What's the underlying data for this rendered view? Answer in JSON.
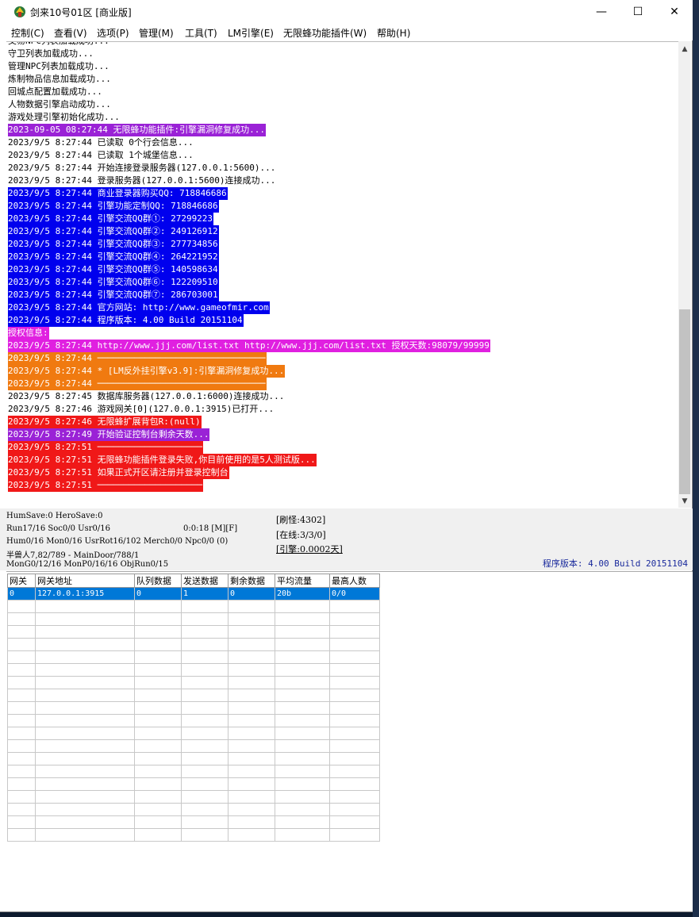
{
  "window": {
    "title": "剑来10号01区 [商业版]",
    "minimize": "—",
    "maximize": "☐",
    "close": "✕"
  },
  "menu": [
    {
      "label": "控制(C)"
    },
    {
      "label": "查看(V)"
    },
    {
      "label": "选项(P)"
    },
    {
      "label": "管理(M)"
    },
    {
      "label": "工具(T)"
    },
    {
      "label": "LM引擎(E)"
    },
    {
      "label": "无限蜂功能插件(W)"
    },
    {
      "label": "帮助(H)"
    }
  ],
  "colors": {
    "purple": "#9a22d6",
    "blue": "#0000ee",
    "magenta": "#e020e0",
    "orange": "#f07a10",
    "red": "#f01818",
    "highlight_row": "#0078d7",
    "version_text": "#1a2a9c"
  },
  "log": [
    {
      "text": "交易NPC列表加载成功...",
      "fg": "#000",
      "bg": ""
    },
    {
      "text": "守卫列表加载成功...",
      "fg": "#000",
      "bg": ""
    },
    {
      "text": "管理NPC列表加载成功...",
      "fg": "#000",
      "bg": ""
    },
    {
      "text": "炼制物品信息加载成功...",
      "fg": "#000",
      "bg": ""
    },
    {
      "text": "回城点配置加载成功...",
      "fg": "#000",
      "bg": ""
    },
    {
      "text": "人物数据引擎启动成功...",
      "fg": "#000",
      "bg": ""
    },
    {
      "text": "游戏处理引擎初始化成功...",
      "fg": "#000",
      "bg": ""
    },
    {
      "text": "2023-09-05 08:27:44 无限蜂功能插件:引擎漏洞修复成功...",
      "fg": "#fff",
      "bg": "#9a22d6"
    },
    {
      "text": "2023/9/5 8:27:44 已读取 0个行会信息...",
      "fg": "#000",
      "bg": ""
    },
    {
      "text": "2023/9/5 8:27:44 已读取 1个城堡信息...",
      "fg": "#000",
      "bg": ""
    },
    {
      "text": "2023/9/5 8:27:44 开始连接登录服务器(127.0.0.1:5600)...",
      "fg": "#000",
      "bg": ""
    },
    {
      "text": "2023/9/5 8:27:44 登录服务器(127.0.0.1:5600)连接成功...",
      "fg": "#000",
      "bg": ""
    },
    {
      "text": "2023/9/5 8:27:44 商业登录器购买QQ: 718846686",
      "fg": "#fff",
      "bg": "#0000ee"
    },
    {
      "text": "2023/9/5 8:27:44 引擎功能定制QQ: 718846686",
      "fg": "#fff",
      "bg": "#0000ee"
    },
    {
      "text": "2023/9/5 8:27:44 引擎交流QQ群①: 27299223",
      "fg": "#fff",
      "bg": "#0000ee"
    },
    {
      "text": "2023/9/5 8:27:44 引擎交流QQ群②: 249126912",
      "fg": "#fff",
      "bg": "#0000ee"
    },
    {
      "text": "2023/9/5 8:27:44 引擎交流QQ群③: 277734856",
      "fg": "#fff",
      "bg": "#0000ee"
    },
    {
      "text": "2023/9/5 8:27:44 引擎交流QQ群④: 264221952",
      "fg": "#fff",
      "bg": "#0000ee"
    },
    {
      "text": "2023/9/5 8:27:44 引擎交流QQ群⑤: 140598634",
      "fg": "#fff",
      "bg": "#0000ee"
    },
    {
      "text": "2023/9/5 8:27:44 引擎交流QQ群⑥: 122209510",
      "fg": "#fff",
      "bg": "#0000ee"
    },
    {
      "text": "2023/9/5 8:27:44 引擎交流QQ群⑦: 286703001",
      "fg": "#fff",
      "bg": "#0000ee"
    },
    {
      "text": "2023/9/5 8:27:44 官方网站: http://www.gameofmir.com",
      "fg": "#fff",
      "bg": "#0000ee"
    },
    {
      "text": "2023/9/5 8:27:44 程序版本: 4.00 Build 20151104",
      "fg": "#fff",
      "bg": "#0000ee"
    },
    {
      "text": "授权信息:",
      "fg": "#fff",
      "bg": "#e020e0"
    },
    {
      "text": "2023/9/5 8:27:44 http://www.jjj.com/list.txt http://www.jjj.com/list.txt 授权天数:98079/99999",
      "fg": "#fff",
      "bg": "#e020e0"
    },
    {
      "text": "2023/9/5 8:27:44 ────────────────────────────────",
      "fg": "#fff",
      "bg": "#f07a10"
    },
    {
      "text": "2023/9/5 8:27:44 * [LM反外挂引擎v3.9]:引擎漏洞修复成功...",
      "fg": "#fff",
      "bg": "#f07a10"
    },
    {
      "text": "2023/9/5 8:27:44 ────────────────────────────────",
      "fg": "#fff",
      "bg": "#f07a10"
    },
    {
      "text": "2023/9/5 8:27:45 数据库服务器(127.0.0.1:6000)连接成功...",
      "fg": "#000",
      "bg": ""
    },
    {
      "text": "2023/9/5 8:27:46 游戏网关[0](127.0.0.1:3915)已打开...",
      "fg": "#000",
      "bg": ""
    },
    {
      "text": "2023/9/5 8:27:46 无限蜂扩展背包R:(null)",
      "fg": "#fff",
      "bg": "#f01818"
    },
    {
      "text": "2023/9/5 8:27:49 开始验证控制台剩余天数...",
      "fg": "#fff",
      "bg": "#9a22d6"
    },
    {
      "text": "2023/9/5 8:27:51 ────────────────────",
      "fg": "#fff",
      "bg": "#f01818"
    },
    {
      "text": "2023/9/5 8:27:51 无限蜂功能插件登录失败,你目前使用的是5人测试版...",
      "fg": "#fff",
      "bg": "#f01818"
    },
    {
      "text": "2023/9/5 8:27:51 如果正式开区请注册并登录控制台",
      "fg": "#fff",
      "bg": "#f01818"
    },
    {
      "text": "2023/9/5 8:27:51 ────────────────────",
      "fg": "#fff",
      "bg": "#f01818"
    }
  ],
  "status": {
    "hum_save": "HumSave:0 HeroSave:0",
    "run": "Run17/16 Soc0/0 Usr0/16",
    "timer": "0:0:18 [M][F]",
    "hum": "Hum0/16 Mon0/16 UsrRot16/102 Merch0/0 Npc0/0 (0)",
    "monster": "半兽人7,82/789 - MainDoor/788/1",
    "mon_g": "MonG0/12/16 MonP0/16/16 ObjRun0/15",
    "refresh": "[刷怪:4302]",
    "online": "[在线:3/3/0]",
    "engine": "[引擎:0.0002天]",
    "version": "程序版本: 4.00 Build 20151104"
  },
  "grid": {
    "headers": [
      "网关",
      "网关地址",
      "队列数据",
      "发送数据",
      "剩余数据",
      "平均流量",
      "最高人数"
    ],
    "rows": [
      [
        "0",
        "127.0.0.1:3915",
        "0",
        "1",
        "0",
        "20b",
        "0/0"
      ]
    ],
    "empty_rows": 19
  }
}
